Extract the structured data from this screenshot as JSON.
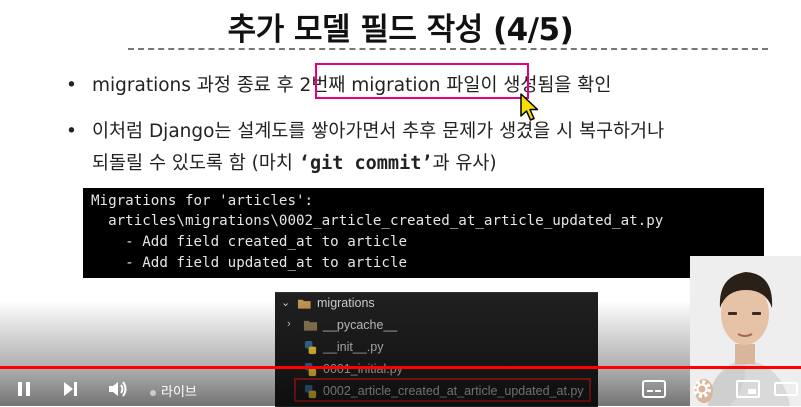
{
  "slide": {
    "title": "추가 모델 필드 작성 (4/5)",
    "bullets": [
      {
        "dot": "•",
        "text_before": "migrations 과정 종료 후 ",
        "highlight": "2번째 migration 파일이",
        "text_after": " 생성됨을 확인"
      },
      {
        "dot": "•",
        "line1": "이처럼 Django는 설계도를 쌓아가면서 추후 문제가 생겼을 시 복구하거나",
        "line2_before": "되돌릴 수 있도록 함 (마치 ",
        "line2_code": "‘git commit’",
        "line2_after": "과 유사)"
      }
    ]
  },
  "terminal": {
    "lines": [
      "Migrations for 'articles':",
      "  articles\\migrations\\0002_article_created_at_article_updated_at.py",
      "    - Add field created_at to article",
      "    - Add field updated_at to article"
    ]
  },
  "explorer": {
    "folder": "migrations",
    "items": [
      {
        "label": "__pycache__",
        "icon": "folder-icon"
      },
      {
        "label": "__init__.py",
        "icon": "python-icon"
      },
      {
        "label": "0001_initial.py",
        "icon": "python-icon"
      },
      {
        "label": "0002_article_created_at_article_updated_at.py",
        "icon": "python-icon"
      }
    ]
  },
  "player": {
    "live_label": "라이브",
    "progress": 1.0,
    "colors": {
      "progress": "#ff0000",
      "highlight": "#e6007e",
      "selected": "#b81d1d"
    }
  }
}
